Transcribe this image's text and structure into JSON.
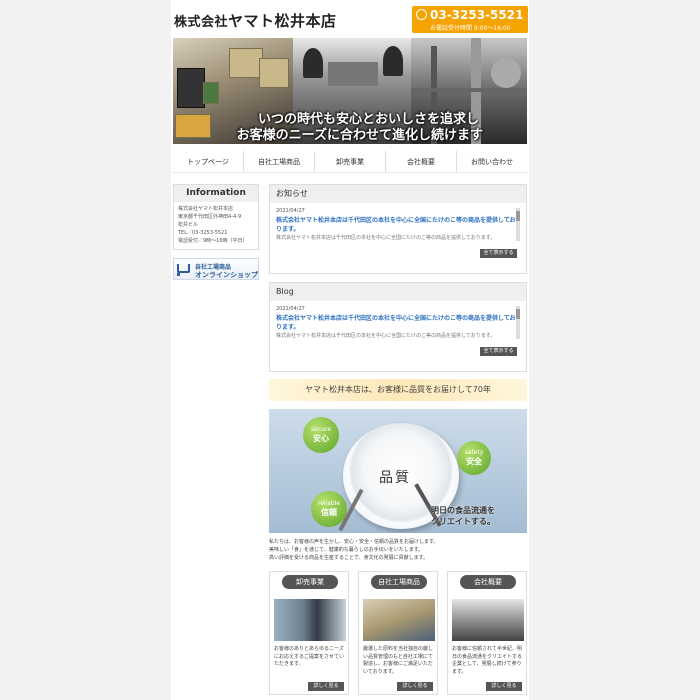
{
  "header": {
    "company_prefix": "株式会社",
    "company_name": "ヤマト松井本店",
    "phone": "03-3253-5521",
    "phone_hours": "お電話受付時間 9:00～16:00"
  },
  "hero": {
    "line1": "いつの時代も安心とおいしさを追求し",
    "line2": "お客様のニーズに合わせて進化し続けます"
  },
  "nav": {
    "items": [
      "トップページ",
      "自社工場商品",
      "卸売事業",
      "会社概要",
      "お問い合わせ"
    ]
  },
  "sidebar": {
    "info_title": "Information",
    "info_lines": [
      "株式会社ヤマト松井本店",
      "東京都千代田区外神田4-4-9",
      "松井ビル",
      "TEL／03-3253-5521",
      "電話受付／9時～16時（平日）"
    ],
    "shop_line1": "自社工場商品",
    "shop_line2": "オンラインショップ"
  },
  "news": {
    "title": "お知らせ",
    "date": "2021/04/27",
    "headline": "株式会社ヤマト松井本店は千代田区の本社を中心に全国にたけのこ等の商品を提供しております。",
    "more": "全て表示する"
  },
  "blog": {
    "title": "Blog",
    "date": "2021/04/27",
    "headline": "株式会社ヤマト松井本店は千代田区の本社を中心に全国にたけのこ等の商品を提供しております。",
    "more": "全て表示する"
  },
  "tagline": "ヤマト松井本店は、お客様に品質をお届けして70年",
  "plate": {
    "center": "品質",
    "bubbles": [
      {
        "en": "secure",
        "jp": "安心"
      },
      {
        "en": "safety",
        "jp": "安全"
      },
      {
        "en": "reliable",
        "jp": "信頼"
      }
    ],
    "copy1": "明日の食品流通を",
    "copy2": "クリエイトする。"
  },
  "intro": [
    "私たちは、お客様の声を生かし、安心・安全・信頼の品質をお届けします。",
    "美味しい「食」を通じて、健康的な暮らしのお手伝いをいたします。",
    "高い評価を受ける商品を生産することで、食文化の発展に貢献します。"
  ],
  "cards": [
    {
      "title": "卸売事業",
      "text": "お客様のありとあらゆるニーズにお応えするご提案をさせていただきます。",
      "button": "詳しく見る"
    },
    {
      "title": "自社工場商品",
      "text": "厳選した原料を当社独自の厳しい品質管理のもと自社工場にて製造し、お客様にご満足いただいております。",
      "button": "詳しく見る"
    },
    {
      "title": "会社概要",
      "text": "お客様に信頼されて半世紀、明日の食品流通をクリエイトする企業として、発展し続けて参ります。",
      "button": "詳しく見る"
    }
  ],
  "colors": {
    "accent": "#f5a300",
    "link": "#2a6fc0",
    "shop": "#2a5d9a"
  }
}
